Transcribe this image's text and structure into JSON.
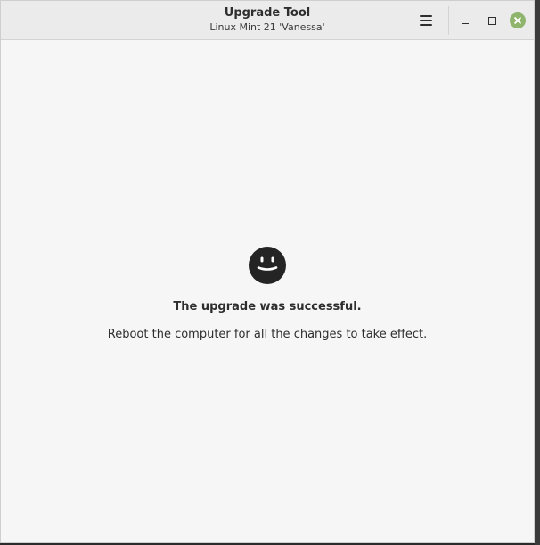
{
  "window": {
    "title": "Upgrade Tool",
    "subtitle": "Linux Mint 21 'Vanessa'"
  },
  "icons": {
    "menu": "hamburger-icon",
    "minimize": "minimize-icon",
    "maximize": "maximize-icon",
    "close": "close-icon",
    "status": "smiley-icon"
  },
  "status": {
    "title": "The upgrade was successful.",
    "message": "Reboot the computer for all the changes to take effect."
  },
  "colors": {
    "close_button": "#8fb56c",
    "window_background": "#f6f6f6",
    "titlebar_background": "#ebebeb",
    "text": "#2e2e2e"
  }
}
